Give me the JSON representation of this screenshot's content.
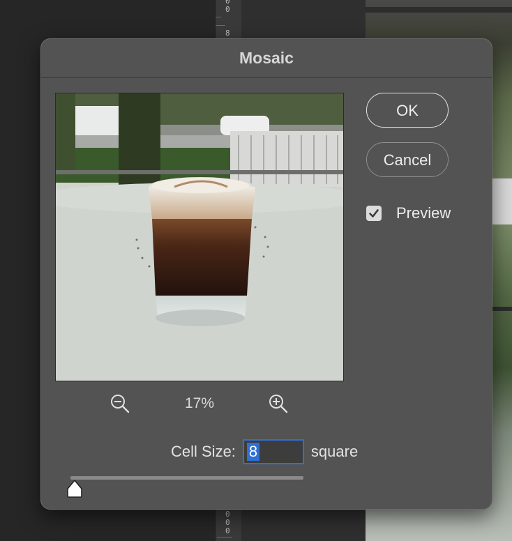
{
  "background": {
    "ruler_top_digits": [
      "0",
      "0",
      "8"
    ],
    "ruler_bottom_digits": [
      "0",
      "0",
      "0",
      "0"
    ]
  },
  "dialog": {
    "title": "Mosaic",
    "buttons": {
      "ok": "OK",
      "cancel": "Cancel"
    },
    "preview_checkbox": {
      "label": "Preview",
      "checked": true
    },
    "zoom": {
      "level": "17%",
      "zoom_out_icon": "zoom-out-magnifier",
      "zoom_in_icon": "zoom-in-magnifier"
    },
    "cell_size": {
      "label": "Cell Size:",
      "value": "8",
      "unit": "square"
    },
    "slider": {
      "value": 8,
      "fraction": 0.0
    }
  },
  "colors": {
    "dialog_bg": "#535353",
    "accent": "#2f6fd6",
    "text": "#ececec"
  }
}
